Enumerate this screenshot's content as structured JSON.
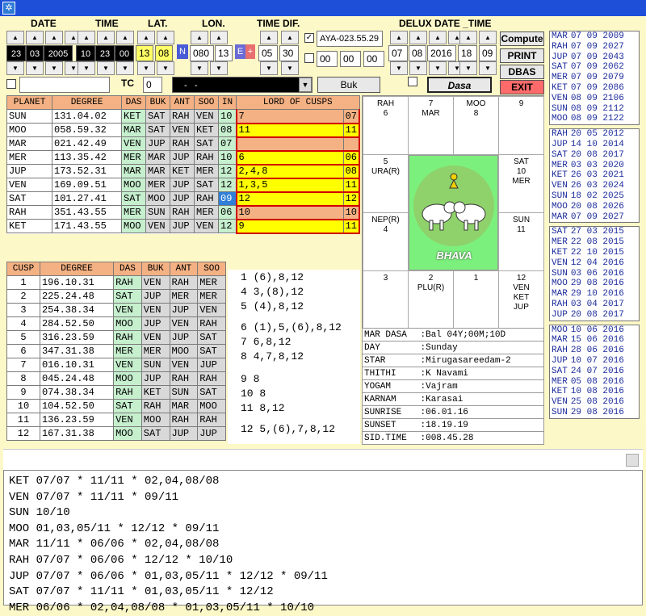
{
  "header_labels": {
    "date": "DATE",
    "time": "TIME",
    "lat": "LAT.",
    "lon": "LON.",
    "timedif": "TIME DIF.",
    "delux": "DELUX DATE _TIME",
    "tc": "TC"
  },
  "date": [
    "23",
    "03",
    "2005"
  ],
  "time": [
    "10",
    "23",
    "00"
  ],
  "lat": [
    "13",
    "08"
  ],
  "lat_dir": "N",
  "lon": [
    "080",
    "13"
  ],
  "lon_dir": "E",
  "lon_sign": "+",
  "timedif": [
    "05",
    "30"
  ],
  "aya": "AYA-023.55.29",
  "aya_sub": [
    "00",
    "00",
    "00"
  ],
  "delux": [
    "07",
    "08",
    "2016",
    "18",
    "09"
  ],
  "tc_value": "0",
  "combo_value": "-   -",
  "buttons": {
    "buk": "Buk",
    "dasa": "Dasa",
    "compute": "Compute",
    "print": "PRINT",
    "dbas": "DBAS",
    "exit": "EXIT"
  },
  "planet_table": {
    "headers": [
      "PLANET",
      "DEGREE",
      "DAS",
      "BUK",
      "ANT",
      "SOO",
      "IN",
      "LORD OF CUSPS"
    ],
    "rows": [
      {
        "planet": "SUN",
        "degree": "131.04.02",
        "das": "KET",
        "buk": "SAT",
        "ant": "RAH",
        "soo": "VEN",
        "in": "10",
        "lord": "7",
        "right": "07"
      },
      {
        "planet": "MOO",
        "degree": "058.59.32",
        "das": "MAR",
        "buk": "SAT",
        "ant": "VEN",
        "soo": "KET",
        "in": "08",
        "lord": "11",
        "right": "11"
      },
      {
        "planet": "MAR",
        "degree": "021.42.49",
        "das": "VEN",
        "buk": "JUP",
        "ant": "RAH",
        "soo": "SAT",
        "in": "07",
        "lord": "",
        "right": ""
      },
      {
        "planet": "MER",
        "degree": "113.35.42",
        "das": "MER",
        "buk": "MAR",
        "ant": "JUP",
        "soo": "RAH",
        "in": "10",
        "lord": "6",
        "right": "06"
      },
      {
        "planet": "JUP",
        "degree": "173.52.31",
        "das": "MAR",
        "buk": "MAR",
        "ant": "KET",
        "soo": "MER",
        "in": "12",
        "lord": "2,4,8",
        "right": "08"
      },
      {
        "planet": "VEN",
        "degree": "169.09.51",
        "das": "MOO",
        "buk": "MER",
        "ant": "JUP",
        "soo": "SAT",
        "in": "12",
        "lord": "1,3,5",
        "right": "11"
      },
      {
        "planet": "SAT",
        "degree": "101.27.41",
        "das": "SAT",
        "buk": "MOO",
        "ant": "JUP",
        "soo": "RAH",
        "in": "09",
        "lord": "12",
        "right": "12"
      },
      {
        "planet": "RAH",
        "degree": "351.43.55",
        "das": "MER",
        "buk": "SUN",
        "ant": "RAH",
        "soo": "MER",
        "in": "06",
        "lord": "10",
        "right": "10"
      },
      {
        "planet": "KET",
        "degree": "171.43.55",
        "das": "MOO",
        "buk": "VEN",
        "ant": "JUP",
        "soo": "VEN",
        "in": "12",
        "lord": "9",
        "right": "11"
      }
    ]
  },
  "cusp_table": {
    "headers": [
      "CUSP",
      "DEGREE",
      "DAS",
      "BUK",
      "ANT",
      "SOO"
    ],
    "rows": [
      [
        "1",
        "196.10.31",
        "RAH",
        "VEN",
        "RAH",
        "MER"
      ],
      [
        "2",
        "225.24.48",
        "SAT",
        "JUP",
        "MER",
        "MER"
      ],
      [
        "3",
        "254.38.34",
        "VEN",
        "VEN",
        "JUP",
        "VEN"
      ],
      [
        "4",
        "284.52.50",
        "MOO",
        "JUP",
        "VEN",
        "RAH"
      ],
      [
        "5",
        "316.23.59",
        "RAH",
        "VEN",
        "JUP",
        "SAT"
      ],
      [
        "6",
        "347.31.38",
        "MER",
        "MER",
        "MOO",
        "SAT"
      ],
      [
        "7",
        "016.10.31",
        "VEN",
        "SUN",
        "VEN",
        "JUP"
      ],
      [
        "8",
        "045.24.48",
        "MOO",
        "JUP",
        "RAH",
        "RAH"
      ],
      [
        "9",
        "074.38.34",
        "RAH",
        "KET",
        "SUN",
        "SAT"
      ],
      [
        "10",
        "104.52.50",
        "SAT",
        "RAH",
        "MAR",
        "MOO"
      ],
      [
        "11",
        "136.23.59",
        "VEN",
        "MOO",
        "RAH",
        "RAH"
      ],
      [
        "12",
        "167.31.38",
        "MOO",
        "SAT",
        "JUP",
        "JUP"
      ]
    ]
  },
  "cusp_lords": [
    "1 (6),8,12",
    "4 3,(8),12",
    "5 (4),8,12",
    "6 (1),5,(6),8,12",
    "7 6,8,12",
    "8 4,7,8,12",
    "9 8",
    "10 8",
    "11 8,12",
    "12 5,(6),7,8,12"
  ],
  "chart": {
    "cells": [
      "RAH\n6",
      "7\nMAR",
      "MOO\n8",
      "9",
      "SAT\n10\nMER",
      "SUN\n11",
      "12\nVEN\nKET\nJUP",
      "1",
      "2\nPLU(R)",
      "3",
      "NEP(R)\n4",
      "5\nURA(R)"
    ],
    "center_label": "BHAVA"
  },
  "info_rows": [
    [
      "MAR DASA",
      ":Bal 04Y;00M;10D"
    ],
    [
      "DAY",
      ":Sunday"
    ],
    [
      "STAR",
      ":Mirugasareedam-2"
    ],
    [
      "THITHI",
      ":K Navami"
    ],
    [
      "YOGAM",
      ":Vajram"
    ],
    [
      "KARNAM",
      ":Karasai"
    ],
    [
      "SUNRISE",
      ":06.01.16"
    ],
    [
      "SUNSET",
      ":18.19.19"
    ],
    [
      "SID.TIME",
      ":008.45.28"
    ]
  ],
  "dasa_groups": [
    [
      [
        "MAR",
        "07 09 2009"
      ],
      [
        "RAH",
        "07 09 2027"
      ],
      [
        "JUP",
        "07 09 2043"
      ],
      [
        "SAT",
        "07 09 2062"
      ],
      [
        "MER",
        "07 09 2079"
      ],
      [
        "KET",
        "07 09 2086"
      ],
      [
        "VEN",
        "08 09 2106"
      ],
      [
        "SUN",
        "08 09 2112"
      ],
      [
        "MOO",
        "08 09 2122"
      ]
    ],
    [
      [
        "RAH",
        "20 05 2012"
      ],
      [
        "JUP",
        "14 10 2014"
      ],
      [
        "SAT",
        "20 08 2017"
      ],
      [
        "MER",
        "03 03 2020"
      ],
      [
        "KET",
        "26 03 2021"
      ],
      [
        "VEN",
        "26 03 2024"
      ],
      [
        "SUN",
        "18 02 2025"
      ],
      [
        "MOO",
        "20 08 2026"
      ],
      [
        "MAR",
        "07 09 2027"
      ]
    ],
    [
      [
        "SAT",
        "27 03 2015"
      ],
      [
        "MER",
        "22 08 2015"
      ],
      [
        "KET",
        "22 10 2015"
      ],
      [
        "VEN",
        "12 04 2016"
      ],
      [
        "SUN",
        "03 06 2016"
      ],
      [
        "MOO",
        "29 08 2016"
      ],
      [
        "MAR",
        "29 10 2016"
      ],
      [
        "RAH",
        "03 04 2017"
      ],
      [
        "JUP",
        "20 08 2017"
      ]
    ],
    [
      [
        "MOO",
        "10 06 2016"
      ],
      [
        "MAR",
        "15 06 2016"
      ],
      [
        "RAH",
        "28 06 2016"
      ],
      [
        "JUP",
        "10 07 2016"
      ],
      [
        "SAT",
        "24 07 2016"
      ],
      [
        "MER",
        "05 08 2016"
      ],
      [
        "KET",
        "10 08 2016"
      ],
      [
        "VEN",
        "25 08 2016"
      ],
      [
        "SUN",
        "29 08 2016"
      ]
    ]
  ],
  "bottom_lines": [
    "KET 07/07 * 11/11 * 02,04,08/08",
    "VEN 07/07 * 11/11 * 09/11",
    "SUN 10/10",
    "MOO 01,03,05/11 * 12/12 * 09/11",
    "MAR 11/11 * 06/06 * 02,04,08/08",
    "RAH 07/07 * 06/06 * 12/12 * 10/10",
    "JUP 07/07 * 06/06 * 01,03,05/11 * 12/12 * 09/11",
    "SAT 07/07 * 11/11 * 01,03,05/11 * 12/12",
    "MER 06/06 * 02,04,08/08 * 01,03,05/11 * 10/10"
  ],
  "colors": {
    "das": "#c6efce",
    "buk": "#d9d9d9",
    "lord_yellow": "#ffff00",
    "red_border": "#d00000",
    "exit": "#ff6b6b",
    "title": "#1d4fd8"
  }
}
